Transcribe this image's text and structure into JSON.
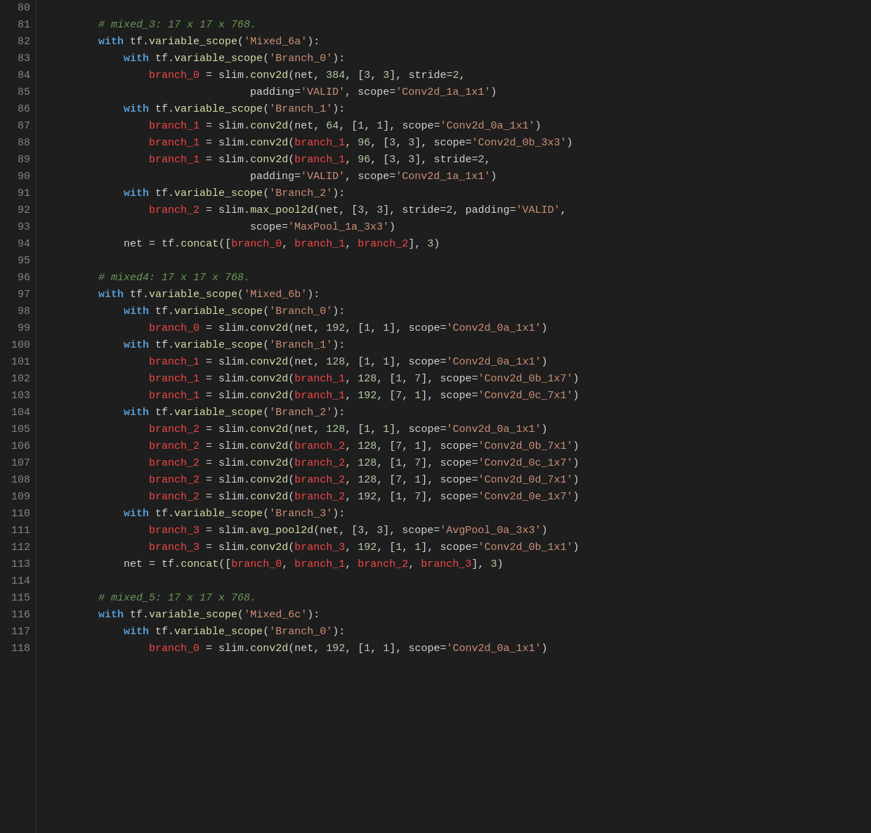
{
  "editor": {
    "background": "#1e1e1e",
    "lineNumberColor": "#858585",
    "lines": [
      {
        "num": 80,
        "indent": 0,
        "tokens": []
      },
      {
        "num": 81,
        "indent": 2,
        "comment": "# mixed_3: 17 x 17 x 768."
      },
      {
        "num": 82,
        "indent": 2,
        "code": "with tf.variable_scope('Mixed_6a'):"
      },
      {
        "num": 83,
        "indent": 3,
        "code": "with tf.variable_scope('Branch_0'):"
      },
      {
        "num": 84,
        "indent": 4,
        "code": "branch_0 = slim.conv2d(net, 384, [3, 3], stride=2,"
      },
      {
        "num": 85,
        "indent": 8,
        "code": "padding='VALID', scope='Conv2d_1a_1x1')"
      },
      {
        "num": 86,
        "indent": 3,
        "code": "with tf.variable_scope('Branch_1'):"
      },
      {
        "num": 87,
        "indent": 4,
        "code": "branch_1 = slim.conv2d(net, 64, [1, 1], scope='Conv2d_0a_1x1')"
      },
      {
        "num": 88,
        "indent": 4,
        "code": "branch_1 = slim.conv2d(branch_1, 96, [3, 3], scope='Conv2d_0b_3x3')"
      },
      {
        "num": 89,
        "indent": 4,
        "code": "branch_1 = slim.conv2d(branch_1, 96, [3, 3], stride=2,"
      },
      {
        "num": 90,
        "indent": 8,
        "code": "padding='VALID', scope='Conv2d_1a_1x1')"
      },
      {
        "num": 91,
        "indent": 3,
        "code": "with tf.variable_scope('Branch_2'):"
      },
      {
        "num": 92,
        "indent": 4,
        "code": "branch_2 = slim.max_pool2d(net, [3, 3], stride=2, padding='VALID',"
      },
      {
        "num": 93,
        "indent": 8,
        "code": "scope='MaxPool_1a_3x3')"
      },
      {
        "num": 94,
        "indent": 3,
        "code": "net = tf.concat([branch_0, branch_1, branch_2], 3)"
      },
      {
        "num": 95,
        "indent": 0,
        "code": ""
      },
      {
        "num": 96,
        "indent": 2,
        "comment": "# mixed4: 17 x 17 x 768."
      },
      {
        "num": 97,
        "indent": 2,
        "code": "with tf.variable_scope('Mixed_6b'):"
      },
      {
        "num": 98,
        "indent": 3,
        "code": "with tf.variable_scope('Branch_0'):"
      },
      {
        "num": 99,
        "indent": 4,
        "code": "branch_0 = slim.conv2d(net, 192, [1, 1], scope='Conv2d_0a_1x1')"
      },
      {
        "num": 100,
        "indent": 3,
        "code": "with tf.variable_scope('Branch_1'):"
      },
      {
        "num": 101,
        "indent": 4,
        "code": "branch_1 = slim.conv2d(net, 128, [1, 1], scope='Conv2d_0a_1x1')"
      },
      {
        "num": 102,
        "indent": 4,
        "code": "branch_1 = slim.conv2d(branch_1, 128, [1, 7], scope='Conv2d_0b_1x7')"
      },
      {
        "num": 103,
        "indent": 4,
        "code": "branch_1 = slim.conv2d(branch_1, 192, [7, 1], scope='Conv2d_0c_7x1')"
      },
      {
        "num": 104,
        "indent": 3,
        "code": "with tf.variable_scope('Branch_2'):"
      },
      {
        "num": 105,
        "indent": 4,
        "code": "branch_2 = slim.conv2d(net, 128, [1, 1], scope='Conv2d_0a_1x1')"
      },
      {
        "num": 106,
        "indent": 4,
        "code": "branch_2 = slim.conv2d(branch_2, 128, [7, 1], scope='Conv2d_0b_7x1')"
      },
      {
        "num": 107,
        "indent": 4,
        "code": "branch_2 = slim.conv2d(branch_2, 128, [1, 7], scope='Conv2d_0c_1x7')"
      },
      {
        "num": 108,
        "indent": 4,
        "code": "branch_2 = slim.conv2d(branch_2, 128, [7, 1], scope='Conv2d_0d_7x1')"
      },
      {
        "num": 109,
        "indent": 4,
        "code": "branch_2 = slim.conv2d(branch_2, 192, [1, 7], scope='Conv2d_0e_1x7')"
      },
      {
        "num": 110,
        "indent": 3,
        "code": "with tf.variable_scope('Branch_3'):"
      },
      {
        "num": 111,
        "indent": 4,
        "code": "branch_3 = slim.avg_pool2d(net, [3, 3], scope='AvgPool_0a_3x3')"
      },
      {
        "num": 112,
        "indent": 4,
        "code": "branch_3 = slim.conv2d(branch_3, 192, [1, 1], scope='Conv2d_0b_1x1')"
      },
      {
        "num": 113,
        "indent": 3,
        "code": "net = tf.concat([branch_0, branch_1, branch_2, branch_3], 3)"
      },
      {
        "num": 114,
        "indent": 0,
        "code": ""
      },
      {
        "num": 115,
        "indent": 2,
        "comment": "# mixed_5: 17 x 17 x 768."
      },
      {
        "num": 116,
        "indent": 2,
        "code": "with tf.variable_scope('Mixed_6c'):"
      },
      {
        "num": 117,
        "indent": 3,
        "code": "with tf.variable_scope('Branch_0'):"
      },
      {
        "num": 118,
        "indent": 4,
        "code": "branch_0 = slim.conv2d(net, 192, [1, 1], scope='Conv2d_0a_1x1')"
      }
    ]
  }
}
